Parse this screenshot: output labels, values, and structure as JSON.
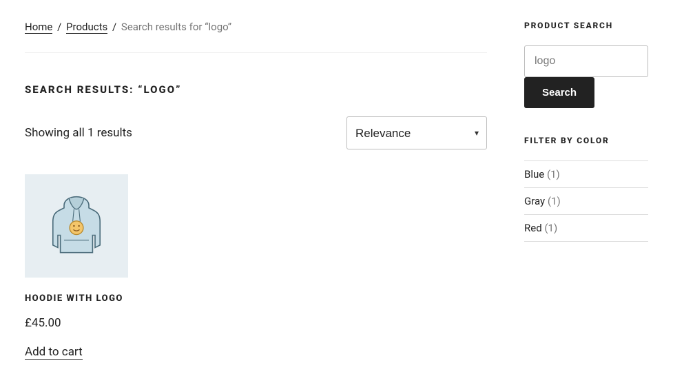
{
  "breadcrumb": {
    "home": "Home",
    "products": "Products",
    "current": "Search results for “logo”"
  },
  "heading": "SEARCH RESULTS: “LOGO”",
  "result_count": "Showing all 1 results",
  "sort": {
    "selected": "Relevance",
    "options": [
      "Relevance"
    ]
  },
  "products": [
    {
      "title": "HOODIE WITH LOGO",
      "price": "£45.00",
      "add_to_cart": "Add to cart",
      "icon": "hoodie-icon"
    }
  ],
  "sidebar": {
    "search": {
      "title": "PRODUCT SEARCH",
      "value": "logo",
      "button": "Search"
    },
    "filter": {
      "title": "FILTER BY COLOR",
      "items": [
        {
          "label": "Blue",
          "count": "(1)"
        },
        {
          "label": "Gray",
          "count": "(1)"
        },
        {
          "label": "Red",
          "count": "(1)"
        }
      ]
    }
  }
}
